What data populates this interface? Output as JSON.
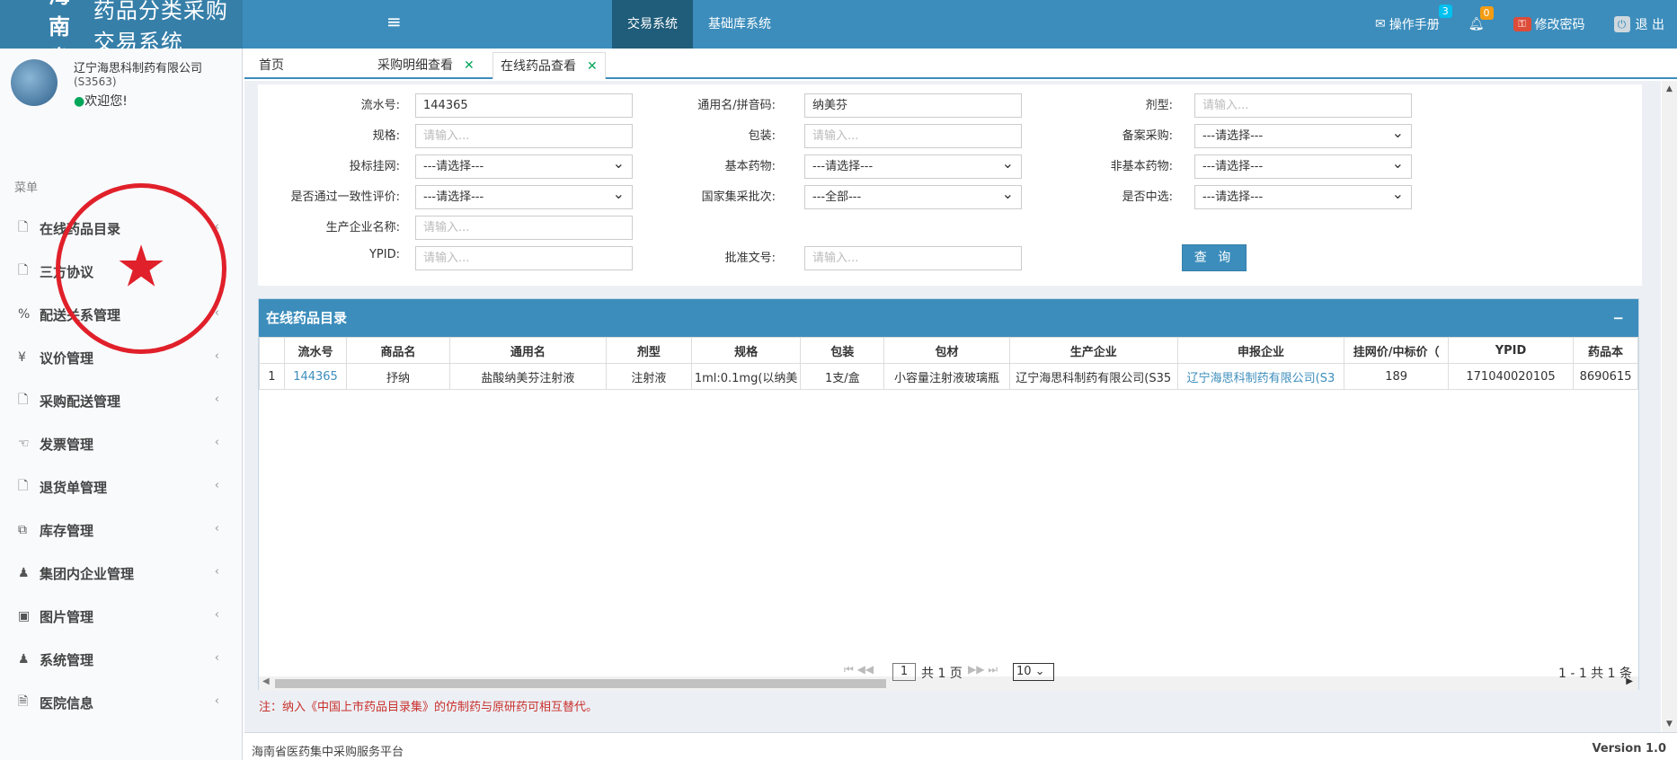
{
  "app": {
    "title_bold": "海南省",
    "title_rest": "药品分类采购交易系统",
    "menu_toggle_glyph": "≡"
  },
  "topnav": {
    "trade": "交易系统",
    "base": "基础库系统"
  },
  "topright": {
    "manual": "操作手册",
    "manual_badge": "3",
    "bell_badge": "0",
    "change_password": "修改密码",
    "logout": "退 出"
  },
  "user": {
    "company": "辽宁海思科制药有限公司",
    "code": "(S3563)",
    "welcome": "欢迎您!"
  },
  "menu": {
    "header": "菜单",
    "items": [
      {
        "label": "在线药品目录",
        "icon": "document-icon"
      },
      {
        "label": "三方协议",
        "icon": "document-icon"
      },
      {
        "label": "配送关系管理",
        "icon": "link-icon"
      },
      {
        "label": "议价管理",
        "icon": "yen-icon"
      },
      {
        "label": "采购配送管理",
        "icon": "document-icon"
      },
      {
        "label": "发票管理",
        "icon": "handshake-icon"
      },
      {
        "label": "退货单管理",
        "icon": "document-icon"
      },
      {
        "label": "库存管理",
        "icon": "cubes-icon"
      },
      {
        "label": "集团内企业管理",
        "icon": "user-icon"
      },
      {
        "label": "图片管理",
        "icon": "image-icon"
      },
      {
        "label": "系统管理",
        "icon": "user-icon"
      },
      {
        "label": "医院信息",
        "icon": "file-text-icon"
      }
    ]
  },
  "tabs": {
    "home": "首页",
    "detail": "采购明细查看",
    "online": "在线药品查看",
    "close_glyph": "✕"
  },
  "form": {
    "serial_label": "流水号:",
    "serial_value": "144365",
    "generic_label": "通用名/拼音码:",
    "generic_value": "纳美芬",
    "dosage_label": "剂型:",
    "spec_label": "规格:",
    "pack_label": "包装:",
    "record_label": "备案采购:",
    "bid_label": "投标挂网:",
    "essential_label": "基本药物:",
    "non_essential_label": "非基本药物:",
    "consistency_label": "是否通过一致性评价:",
    "national_batch_label": "国家集采批次:",
    "selected_label": "是否中选:",
    "maker_label": "生产企业名称:",
    "ypid_label": "YPID:",
    "approval_label": "批准文号:",
    "placeholder": "请输入...",
    "select_default": "---请选择---",
    "select_all": "---全部---",
    "query_button": "查 询"
  },
  "grid": {
    "title": "在线药品目录",
    "collapse_glyph": "−",
    "columns": [
      "",
      "流水号",
      "商品名",
      "通用名",
      "剂型",
      "规格",
      "包装",
      "包材",
      "生产企业",
      "申报企业",
      "挂网价/中标价（",
      "YPID",
      "药品本"
    ],
    "rows": [
      [
        "1",
        "144365",
        "抒纳",
        "盐酸纳美芬注射液",
        "注射液",
        "1ml:0.1mg(以纳美",
        "1支/盒",
        "小容量注射液玻璃瓶",
        "辽宁海思科制药有限公司(S35",
        "辽宁海思科制药有限公司(S3",
        "189",
        "171040020105",
        "8690615"
      ]
    ]
  },
  "pager": {
    "first_prev": "⏮ ◀◀",
    "page": "1",
    "total_pages": "共 1 页",
    "next_last": "▶▶ ⏭",
    "page_size": "10",
    "info": "1 - 1  共 1 条"
  },
  "note": "注：纳入《中国上市药品目录集》的仿制药与原研药可相互替代。",
  "footer": {
    "text": "海南省医药集中采购服务平台",
    "version": "Version 1.0"
  },
  "colors": {
    "header": "#3c8dbc",
    "logo_bg": "#367fa9",
    "active_nav": "#1f5d7a",
    "seal": "#e0202a",
    "note": "#c9302c"
  }
}
